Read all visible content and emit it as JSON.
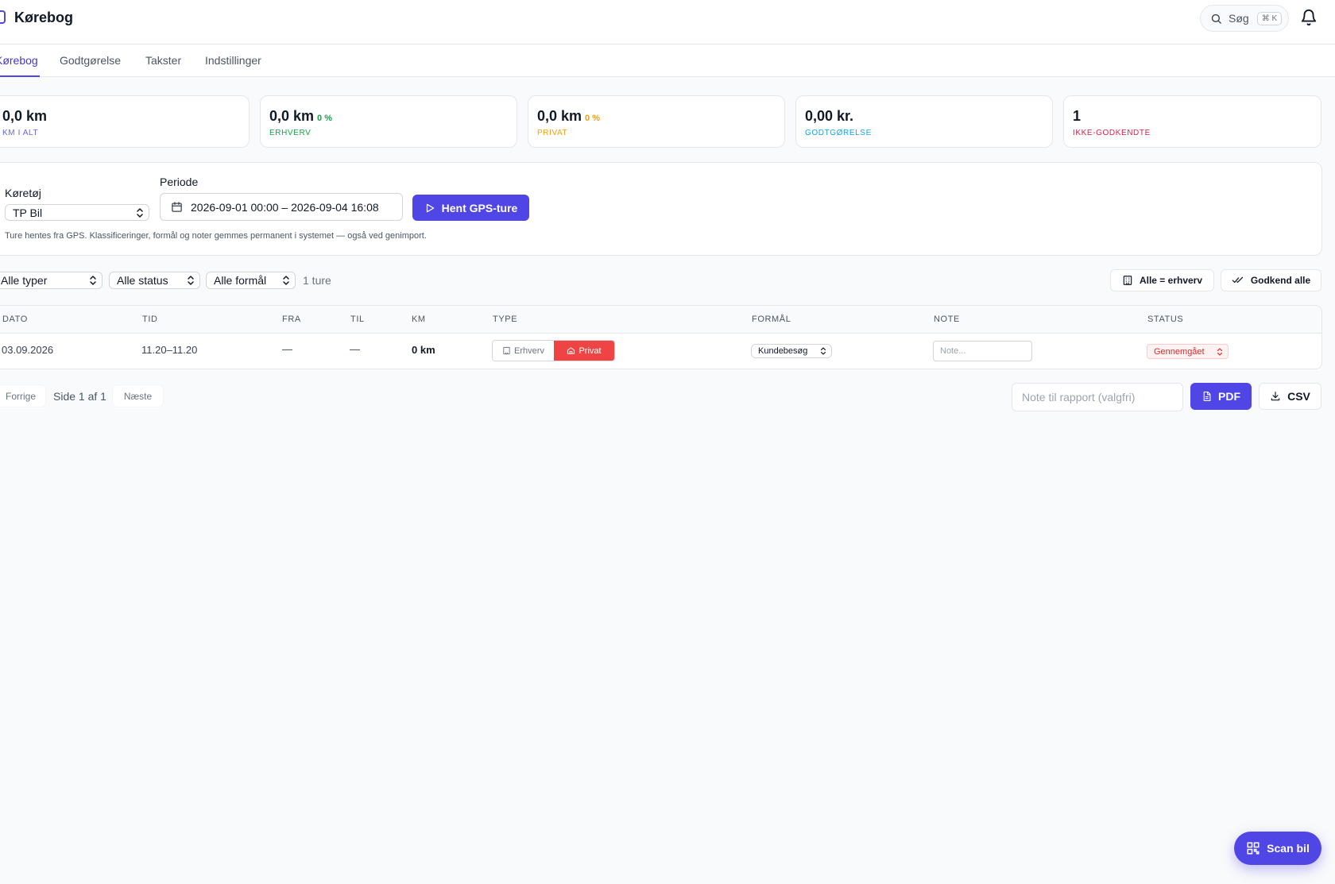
{
  "app": {
    "title": "Kørebog"
  },
  "header": {
    "search_label": "Søg",
    "search_shortcut": "⌘ K"
  },
  "tabs": [
    {
      "label": "Kørebog",
      "active": true
    },
    {
      "label": "Godtgørelse"
    },
    {
      "label": "Takster"
    },
    {
      "label": "Indstillinger"
    }
  ],
  "stats": [
    {
      "value": "0,0 km",
      "percent": "",
      "label": "KM I ALT",
      "color": "#6366f1"
    },
    {
      "value": "0,0 km",
      "percent": "0 %",
      "label": "ERHVERV",
      "color": "#16a34a"
    },
    {
      "value": "0,0 km",
      "percent": "0 %",
      "label": "PRIVAT",
      "color": "#f59e0b"
    },
    {
      "value": "0,00 kr.",
      "percent": "",
      "label": "GODTGØRELSE",
      "color": "#0ea5e9"
    },
    {
      "value": "1",
      "percent": "",
      "label": "IKKE-GODKENDTE",
      "color": "#e11d48"
    }
  ],
  "filters": {
    "vehicle_label": "Køretøj",
    "vehicle_value": "TP Bil",
    "period_label": "Periode",
    "period_value": "2026-09-01 00:00 – 2026-09-04 16:08",
    "fetch_button": "Hent GPS-ture",
    "hint": "Ture hentes fra GPS. Klassificeringer, formål og noter gemmes permanent i systemet — også ved genimport."
  },
  "toolbar": {
    "type_filter": "Alle typer",
    "status_filter": "Alle status",
    "purpose_filter": "Alle formål",
    "trip_count": "1 ture",
    "all_business_button": "Alle = erhverv",
    "approve_all_button": "Godkend alle"
  },
  "table": {
    "headers": [
      "DATO",
      "TID",
      "FRA",
      "TIL",
      "KM",
      "TYPE",
      "FORMÅL",
      "NOTE",
      "STATUS"
    ],
    "rows": [
      {
        "date": "03.09.2026",
        "time": "11.20–11.20",
        "from": "—",
        "to": "—",
        "km": "0 km",
        "type_options": [
          "Erhverv",
          "Privat"
        ],
        "type_selected": "Privat",
        "purpose": "Kundebesøg",
        "note_placeholder": "Note...",
        "status": "Gennemgået"
      }
    ]
  },
  "pagination": {
    "prev": "Forrige",
    "page_label": "Side 1 af 1",
    "next": "Næste"
  },
  "export": {
    "note_placeholder": "Note til rapport (valgfri)",
    "pdf_button": "PDF",
    "csv_button": "CSV"
  },
  "fab": {
    "label": "Scan bil"
  },
  "colors": {
    "primary": "#4f46e5",
    "private": "#ef4444",
    "status_text": "#dc2626"
  }
}
